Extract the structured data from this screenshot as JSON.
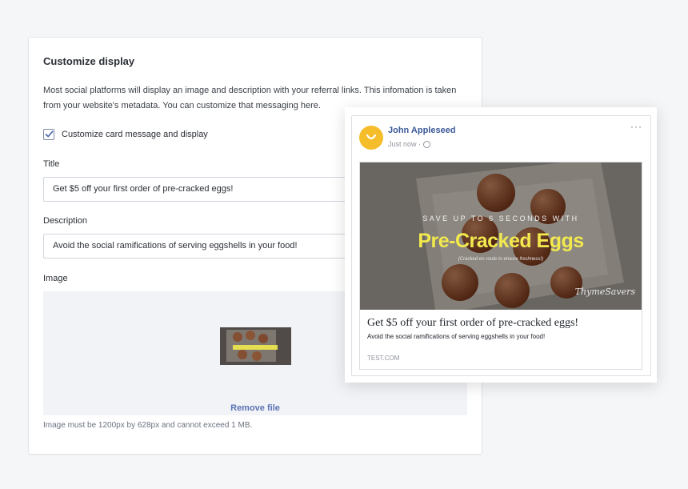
{
  "settings": {
    "title": "Customize display",
    "description": "Most social platforms will display an image and description with your referral links. This infomation is taken from your website's metadata. You can customize that messaging here.",
    "checkbox_label": "Customize card message and display",
    "checkbox_checked": true,
    "title_label": "Title",
    "title_value": "Get $5 off your first order of pre-cracked eggs!",
    "description_label": "Description",
    "description_value": "Avoid the social ramifications of serving eggshells in your food!",
    "image_label": "Image",
    "remove_label": "Remove file",
    "image_hint": "Image must be 1200px by 628px and cannot exceed 1 MB."
  },
  "preview": {
    "author": "John Appleseed",
    "timestamp": "Just now ·",
    "menu_icon": "more-icon",
    "image_subtitle": "SAVE UP TO 6 SECONDS WITH",
    "image_headline": "Pre-Cracked Eggs",
    "image_caption": "(Cracked en-route to ensure freshness!)",
    "image_brand": "ThymeSavers",
    "link_title": "Get $5 off your first order of pre-cracked eggs!",
    "link_description": "Avoid the social ramifications of serving eggshells in your food!",
    "link_domain": "TEST.COM"
  },
  "colors": {
    "accent": "#5b73b5",
    "facebook_blue": "#3b5998",
    "avatar_yellow": "#f6bd2a",
    "headline_yellow": "#f2e94e"
  }
}
